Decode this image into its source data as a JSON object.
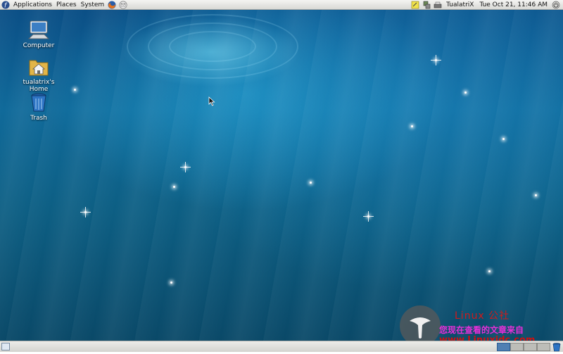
{
  "top_panel": {
    "menus": [
      "Applications",
      "Places",
      "System"
    ],
    "launchers": [
      "firefox-icon",
      "mail-icon"
    ],
    "tray_icons": [
      "notes-icon",
      "network-icon",
      "printer-icon"
    ],
    "user": "TualatriX",
    "clock": "Tue Oct 21, 11:46 AM",
    "end_icon": "power-icon"
  },
  "desktop": {
    "icons": [
      {
        "label": "Computer",
        "icon": "computer-icon"
      },
      {
        "label": "tualatrix's Home",
        "icon": "home-folder-icon"
      },
      {
        "label": "Trash",
        "icon": "trash-icon"
      }
    ]
  },
  "watermark": {
    "title": "Linux 公社",
    "subtitle": "您现在查看的文章来自",
    "url": "www.Linuxidc.com"
  },
  "bottom_panel": {
    "workspaces": 4,
    "active_workspace": 1
  },
  "colors": {
    "panel": "#e3e3df",
    "desktop_top": "#0b4f86",
    "desktop_bottom": "#0a4968",
    "active_workspace": "#4f7fb3"
  }
}
